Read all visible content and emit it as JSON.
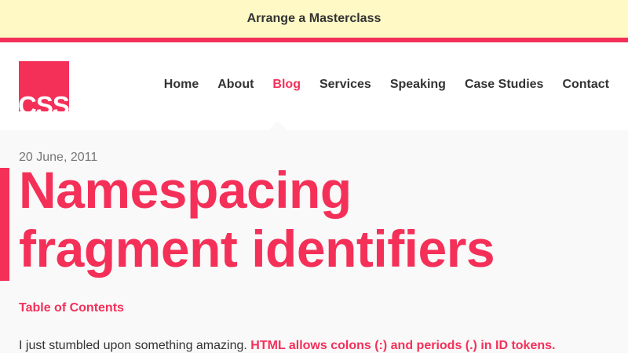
{
  "banner": {
    "label": "Arrange a Masterclass"
  },
  "header": {
    "logo_text": "CSS",
    "nav": [
      {
        "label": "Home",
        "active": false
      },
      {
        "label": "About",
        "active": false
      },
      {
        "label": "Blog",
        "active": true
      },
      {
        "label": "Services",
        "active": false
      },
      {
        "label": "Speaking",
        "active": false
      },
      {
        "label": "Case Studies",
        "active": false
      },
      {
        "label": "Contact",
        "active": false
      }
    ]
  },
  "article": {
    "date": "20 June, 2011",
    "title_line1": "Namespacing",
    "title_line2": "fragment identifiers",
    "toc_label": "Table of Contents",
    "intro_text": "I just stumbled upon something amazing. ",
    "intro_link": "HTML allows colons (:) and periods (.) in ID tokens."
  },
  "colors": {
    "accent": "#f43059",
    "banner_bg": "#fef9c5",
    "text": "#333333",
    "muted": "#777777",
    "page_bg": "#f9f9f9"
  }
}
